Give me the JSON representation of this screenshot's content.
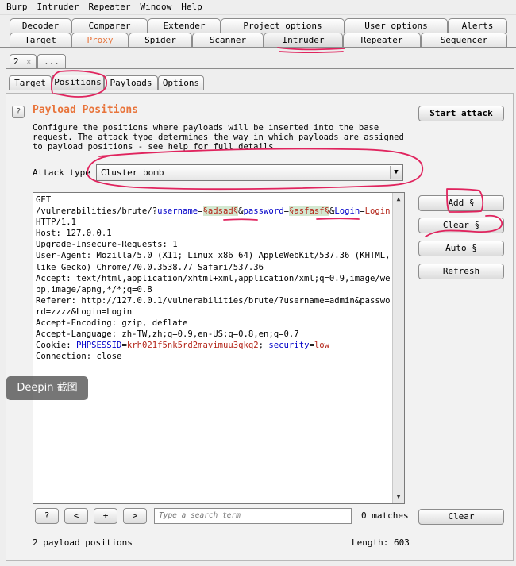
{
  "menu": [
    "Burp",
    "Intruder",
    "Repeater",
    "Window",
    "Help"
  ],
  "tabs_row1": [
    "Decoder",
    "Comparer",
    "Extender",
    "Project options",
    "User options",
    "Alerts"
  ],
  "tabs_row2": [
    "Target",
    "Proxy",
    "Spider",
    "Scanner",
    "Intruder",
    "Repeater",
    "Sequencer"
  ],
  "attack_tabs": {
    "current": "2",
    "close": "×",
    "more": "..."
  },
  "subtabs": [
    "Target",
    "Positions",
    "Payloads",
    "Options"
  ],
  "positions": {
    "help": "?",
    "title": "Payload Positions",
    "description": "Configure the positions where payloads will be inserted into the base request. The attack type determines the way in which payloads are assigned to payload positions - see help for full details.",
    "attack_type_label": "Attack type",
    "attack_type_value": "Cluster bomb"
  },
  "buttons": {
    "start_attack": "Start attack",
    "add": "Add §",
    "clear_markers": "Clear §",
    "auto": "Auto §",
    "refresh": "Refresh",
    "clear": "Clear"
  },
  "request": {
    "line1": "GET",
    "path": "/vulnerabilities/brute/?",
    "p1_name": "username",
    "eq1": "=",
    "p1_marker": "§adsad§",
    "amp1": "&",
    "p2_name": "password",
    "eq2": "=",
    "p2_marker": "§asfasf§",
    "amp2": "&",
    "p3_name": "Login",
    "eq3": "=",
    "p3_value": "Login",
    "proto": " HTTP/1.1",
    "rest1": "Host: 127.0.0.1\nUpgrade-Insecure-Requests: 1\nUser-Agent: Mozilla/5.0 (X11; Linux x86_64) AppleWebKit/537.36 (KHTML, like Gecko) Chrome/70.0.3538.77 Safari/537.36\nAccept: text/html,application/xhtml+xml,application/xml;q=0.9,image/webp,image/apng,*/*;q=0.8\nReferer: http://127.0.0.1/vulnerabilities/brute/?username=admin&password=zzzz&Login=Login\nAccept-Encoding: gzip, deflate\nAccept-Language: zh-TW,zh;q=0.9,en-US;q=0.8,en;q=0.7\n",
    "cookie_label": "Cookie: ",
    "cookie_k1": "PHPSESSID",
    "cookie_eq1": "=",
    "cookie_v1": "krh021f5nk5rd2mavimuu3qkq2",
    "cookie_sep": "; ",
    "cookie_k2": "security",
    "cookie_eq2": "=",
    "cookie_v2": "low",
    "rest2": "\nConnection: close"
  },
  "search": {
    "help": "?",
    "prev": "<",
    "add": "+",
    "next": ">",
    "placeholder": "Type a search term",
    "matches": "0 matches"
  },
  "status": {
    "positions_count": "2 payload positions",
    "length": "Length: 603"
  },
  "watermark": "Deepin 截图",
  "colors": {
    "accent": "#e8743b",
    "annotation": "#e0245e",
    "param_key": "#0000c8",
    "param_value": "#b4261a",
    "marker_bg": "#d3e8d0"
  }
}
